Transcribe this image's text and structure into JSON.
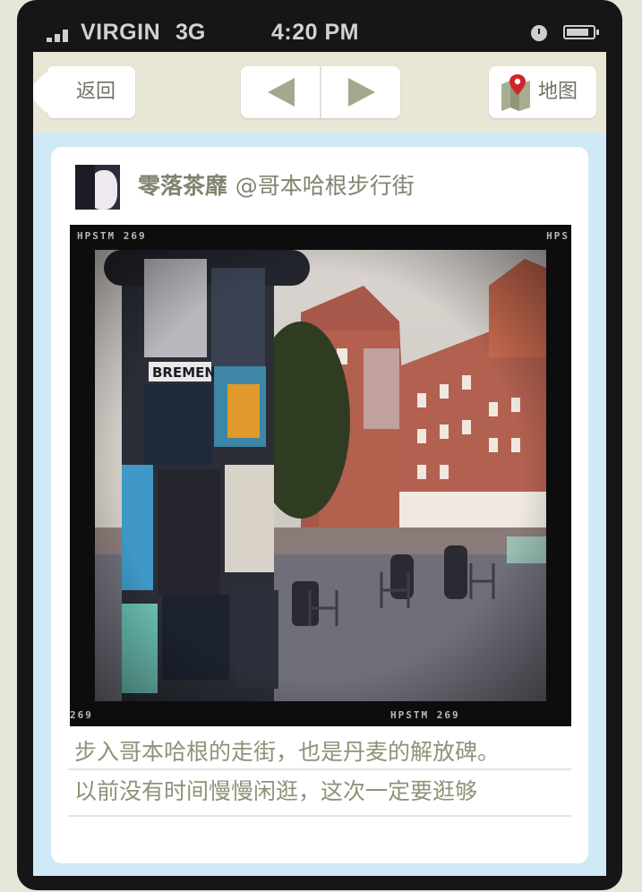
{
  "statusbar": {
    "carrier": "VIRGIN",
    "network": "3G",
    "time": "4:20 PM"
  },
  "navbar": {
    "back_label": "返回",
    "prev_icon": "triangle-left-icon",
    "next_icon": "triangle-right-icon",
    "map_label": "地图",
    "map_icon": "map-pin-icon"
  },
  "post": {
    "user": "零落茶靡",
    "location": "@哥本哈根步行街",
    "photo_text": {
      "top_left": "HPSTM 269",
      "top_right": "HPS",
      "bottom_left": "269",
      "bottom_center": "HPSTM 269"
    },
    "caption_lines": [
      "步入哥本哈根的走街，也是丹麦的解放碑。",
      "以前没有时间慢慢闲逛，这次一定要逛够"
    ]
  },
  "colors": {
    "background": "#e6e6d8",
    "screen_bg": "#cfe9f7",
    "text_muted": "#7f846f",
    "pin_red": "#d2232a"
  }
}
